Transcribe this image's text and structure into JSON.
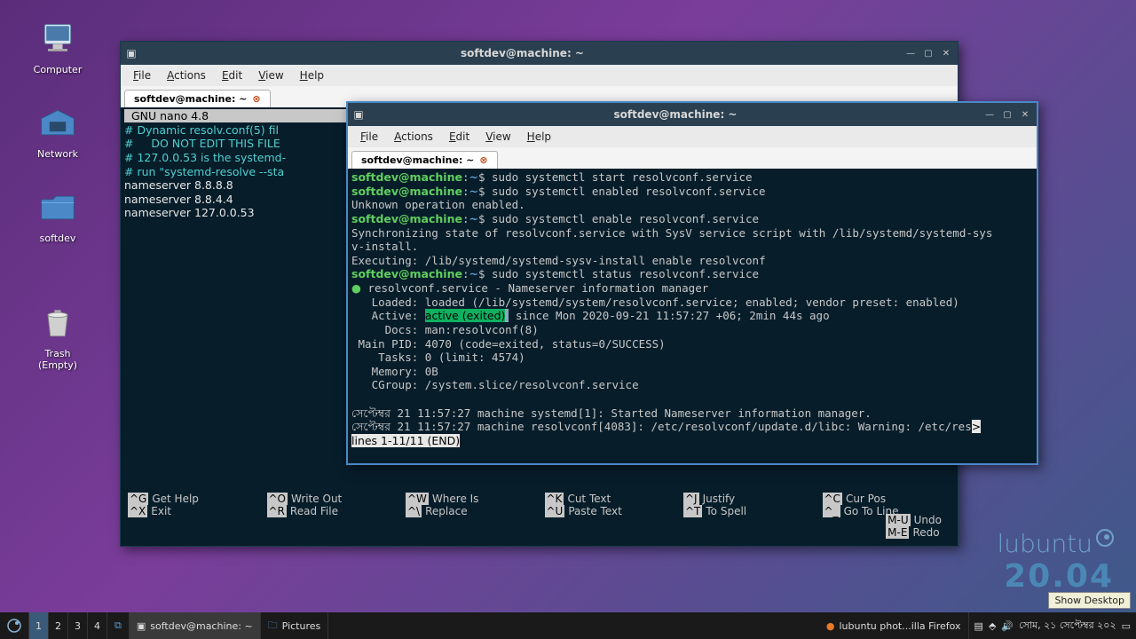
{
  "desktop": {
    "icons": [
      {
        "id": "ico-computer",
        "label": "Computer"
      },
      {
        "id": "ico-network",
        "label": "Network"
      },
      {
        "id": "ico-softdev",
        "label": "softdev"
      },
      {
        "id": "ico-trash",
        "label": "Trash (Empty)"
      }
    ]
  },
  "brand": {
    "name": "lubuntu",
    "version": "20.04"
  },
  "win_back": {
    "title": "softdev@machine: ~",
    "menu": [
      "File",
      "Actions",
      "Edit",
      "View",
      "Help"
    ],
    "tab": "softdev@machine: ~",
    "nano_header": "  GNU nano 4.8",
    "lines": [
      {
        "txt": "# Dynamic resolv.conf(5) fil",
        "cls": "c"
      },
      {
        "txt": "#     DO NOT EDIT THIS FILE ",
        "cls": "c"
      },
      {
        "txt": "# 127.0.0.53 is the systemd-",
        "cls": "c"
      },
      {
        "txt": "# run \"systemd-resolve --sta",
        "cls": "c"
      },
      {
        "txt": "nameserver 8.8.8.8",
        "cls": "w"
      },
      {
        "txt": "nameserver 8.8.4.4",
        "cls": "w"
      },
      {
        "txt": "nameserver 127.0.0.53",
        "cls": "w"
      }
    ],
    "footer": [
      [
        "^G",
        "Get Help"
      ],
      [
        "^O",
        "Write Out"
      ],
      [
        "^W",
        "Where Is"
      ],
      [
        "^K",
        "Cut Text"
      ],
      [
        "^J",
        "Justify"
      ],
      [
        "^C",
        "Cur Pos"
      ],
      [
        "^X",
        "Exit"
      ],
      [
        "^R",
        "Read File"
      ],
      [
        "^\\",
        "Replace"
      ],
      [
        "^U",
        "Paste Text"
      ],
      [
        "^T",
        "To Spell"
      ],
      [
        "^_",
        "Go To Line"
      ]
    ],
    "footer_extra": [
      [
        "M-U",
        "Undo"
      ],
      [
        "M-E",
        "Redo"
      ]
    ]
  },
  "win_front": {
    "title": "softdev@machine: ~",
    "menu": [
      "File",
      "Actions",
      "Edit",
      "View",
      "Help"
    ],
    "tab": "softdev@machine: ~",
    "prompt_user": "softdev@machine",
    "prompt_path": "~",
    "cmds": [
      "sudo systemctl start resolvconf.service",
      "sudo systemctl enabled resolvconf.service"
    ],
    "out1": "Unknown operation enabled.",
    "cmd3": "sudo systemctl enable resolvconf.service",
    "out2a": "Synchronizing state of resolvconf.service with SysV service script with /lib/systemd/systemd-sys",
    "out2b": "v-install.",
    "out2c": "Executing: /lib/systemd/systemd-sysv-install enable resolvconf",
    "cmd4": "sudo systemctl status resolvconf.service",
    "status": {
      "header": "resolvconf.service - Nameserver information manager",
      "loaded": "   Loaded: loaded (/lib/systemd/system/resolvconf.service; enabled; vendor preset: enabled)",
      "active_pre": "   Active: ",
      "active_hl": "active (exited)",
      "active_post": " since Mon 2020-09-21 11:57:27 +06; 2min 44s ago",
      "docs": "     Docs: man:resolvconf(8)",
      "mainpid": " Main PID: 4070 (code=exited, status=0/SUCCESS)",
      "tasks": "    Tasks: 0 (limit: 4574)",
      "memory": "   Memory: 0B",
      "cgroup": "   CGroup: /system.slice/resolvconf.service"
    },
    "log1": "সেপ্টেম্বর 21 11:57:27 machine systemd[1]: Started Nameserver information manager.",
    "log2": "সেপ্টেম্বর 21 11:57:27 machine resolvconf[4083]: /etc/resolvconf/update.d/libc: Warning: /etc/res",
    "pager": "lines 1-11/11 (END)"
  },
  "taskbar": {
    "workspaces": [
      "1",
      "2",
      "3",
      "4"
    ],
    "items": [
      {
        "label": "softdev@machine: ~",
        "icon": "term"
      },
      {
        "label": "Pictures",
        "icon": "folder"
      },
      {
        "label": "lubuntu phot...illa Firefox",
        "icon": "firefox"
      }
    ],
    "clock": "সোম, ২১ সেপ্টেম্বর ২০২",
    "show_desktop": "Show Desktop"
  }
}
